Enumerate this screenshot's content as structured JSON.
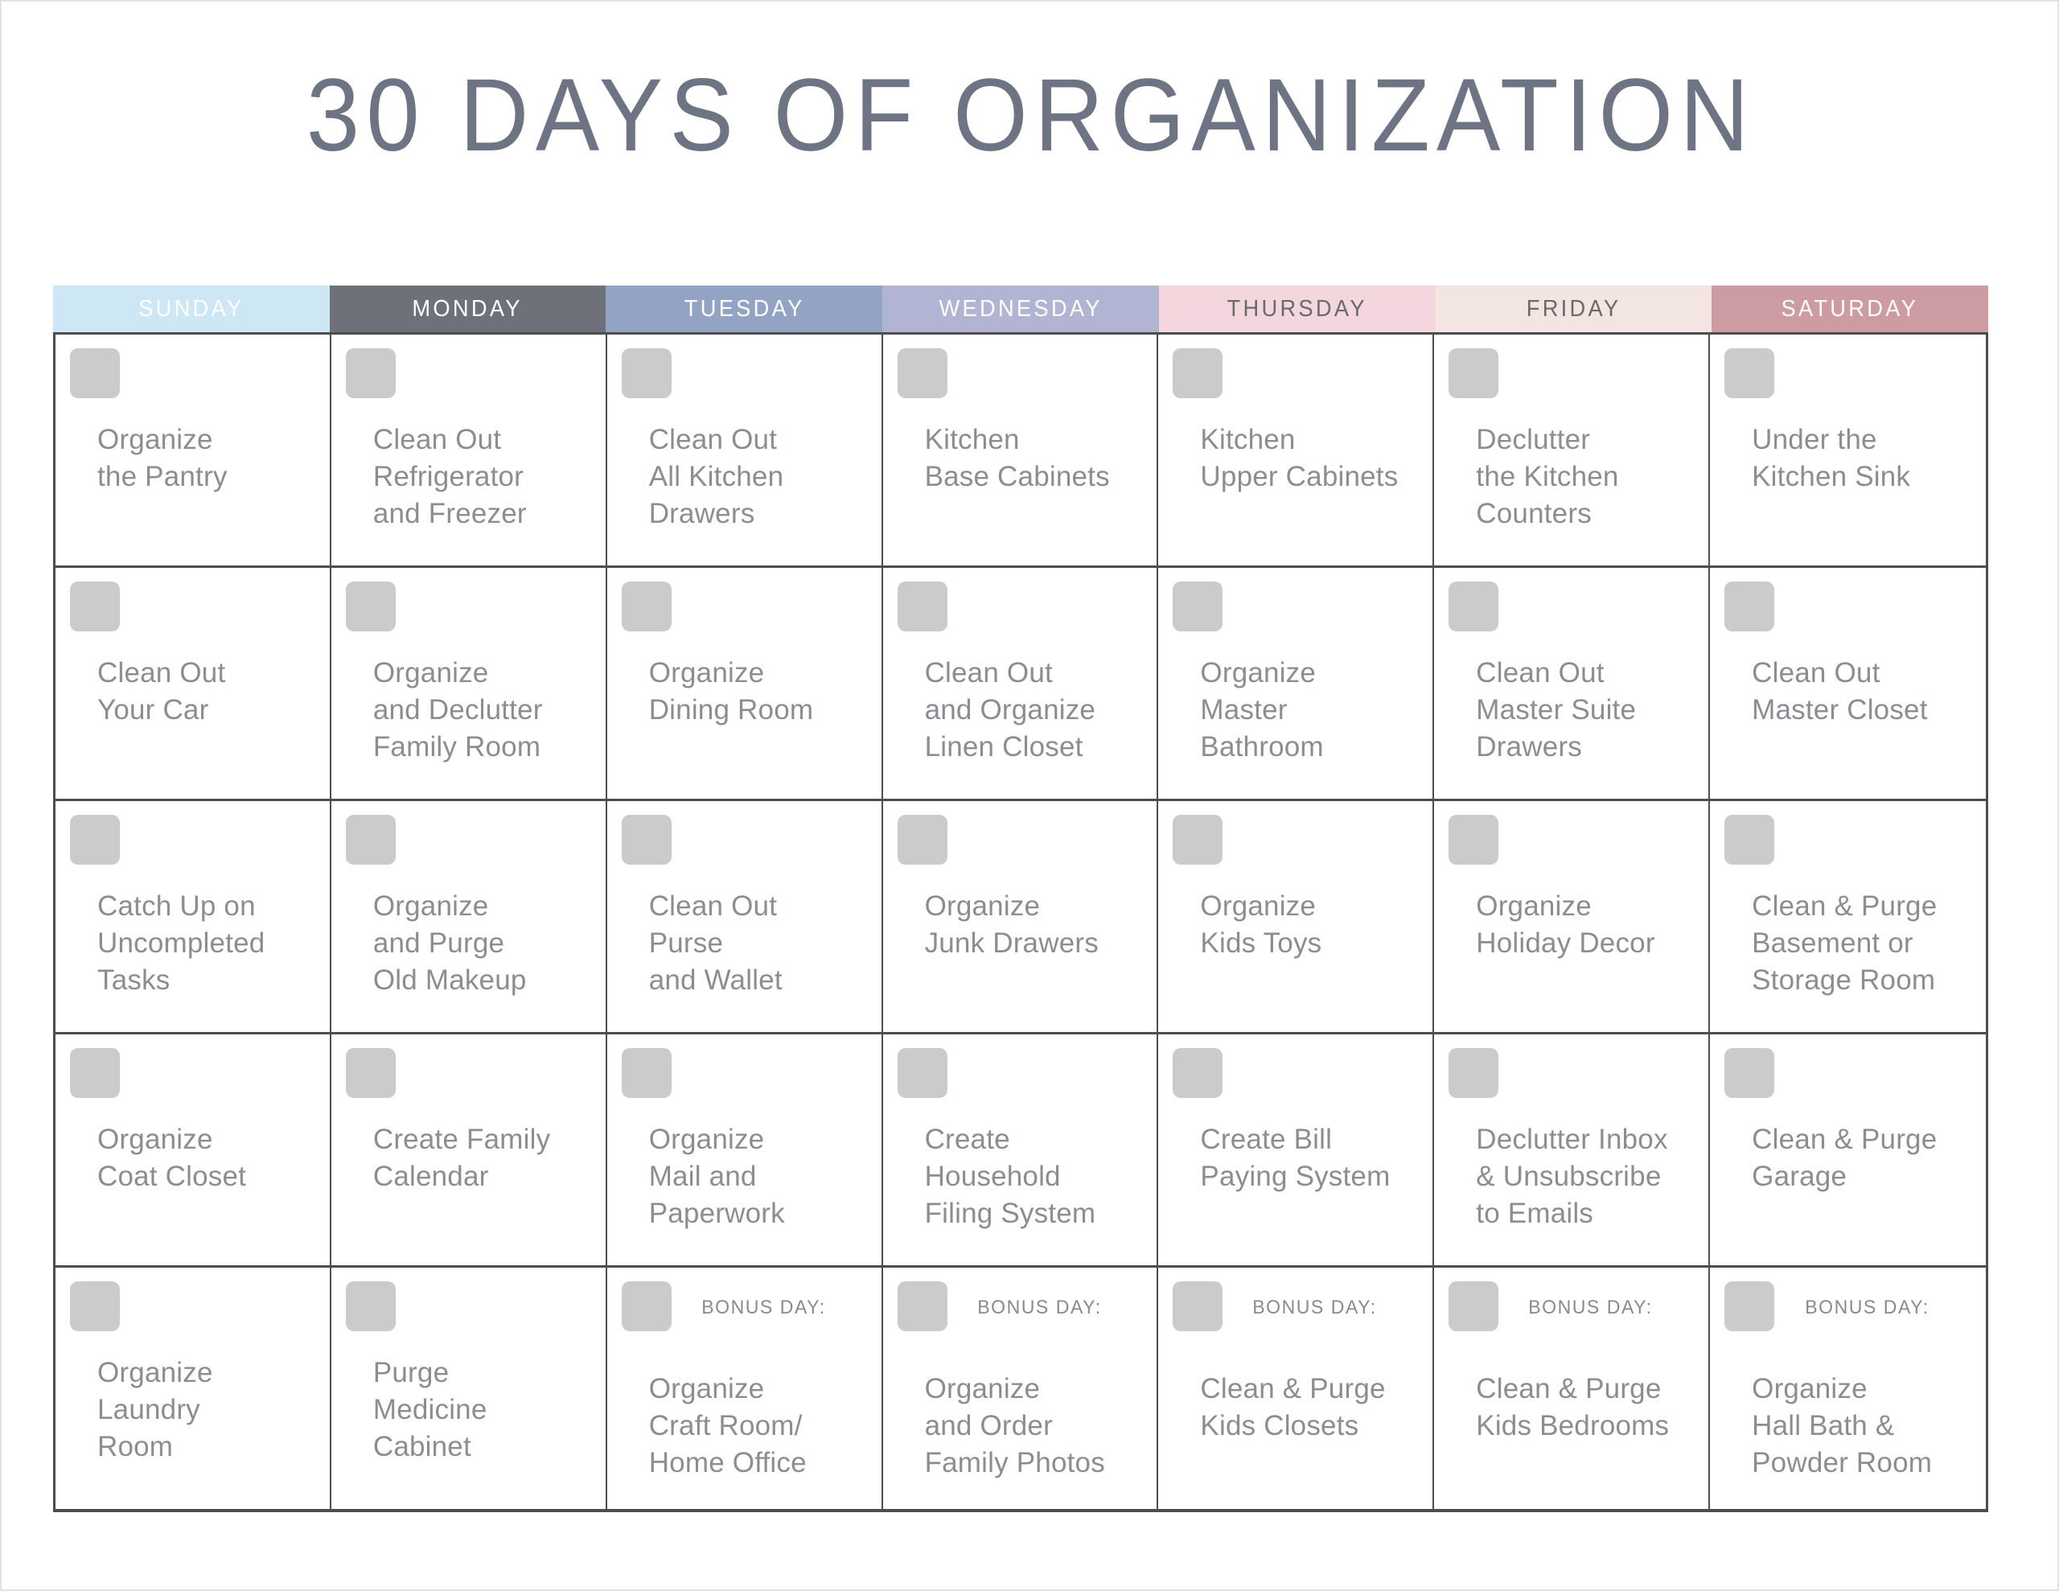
{
  "page": {
    "title": "30 DAYS OF ORGANIZATION",
    "bonus_label": "BONUS DAY:",
    "colors": {
      "title_text": "#6e7484",
      "task_text": "#8a8e93",
      "checkbox": "#cbcbcb",
      "grid_border": "#4d4d4d",
      "page_border": "#e2e2e2"
    }
  },
  "headers": [
    {
      "label": "SUNDAY",
      "bg": "#cde7f4",
      "fg": "#ffffff"
    },
    {
      "label": "MONDAY",
      "bg": "#6f717a",
      "fg": "#ffffff"
    },
    {
      "label": "TUESDAY",
      "bg": "#93a3c4",
      "fg": "#ffffff"
    },
    {
      "label": "WEDNESDAY",
      "bg": "#b1b4d2",
      "fg": "#ffffff"
    },
    {
      "label": "THURSDAY",
      "bg": "#f3d6de",
      "fg": "#6a6a6a"
    },
    {
      "label": "FRIDAY",
      "bg": "#f3e5e2",
      "fg": "#6a6a6a"
    },
    {
      "label": "SATURDAY",
      "bg": "#cd9ba2",
      "fg": "#ffffff"
    }
  ],
  "weeks": [
    [
      {
        "task": "Organize\nthe Pantry",
        "bonus": false
      },
      {
        "task": "Clean Out\nRefrigerator\nand Freezer",
        "bonus": false
      },
      {
        "task": "Clean Out\nAll Kitchen\nDrawers",
        "bonus": false
      },
      {
        "task": "Kitchen\nBase Cabinets",
        "bonus": false
      },
      {
        "task": "Kitchen\nUpper Cabinets",
        "bonus": false
      },
      {
        "task": "Declutter\nthe Kitchen\nCounters",
        "bonus": false
      },
      {
        "task": "Under the\nKitchen Sink",
        "bonus": false
      }
    ],
    [
      {
        "task": "Clean Out\nYour Car",
        "bonus": false
      },
      {
        "task": "Organize\nand Declutter\nFamily Room",
        "bonus": false
      },
      {
        "task": "Organize\nDining Room",
        "bonus": false
      },
      {
        "task": "Clean Out\nand Organize\nLinen Closet",
        "bonus": false
      },
      {
        "task": "Organize\nMaster\nBathroom",
        "bonus": false
      },
      {
        "task": "Clean Out\nMaster Suite\nDrawers",
        "bonus": false
      },
      {
        "task": "Clean Out\nMaster Closet",
        "bonus": false
      }
    ],
    [
      {
        "task": "Catch Up on\nUncompleted\nTasks",
        "bonus": false
      },
      {
        "task": "Organize\nand Purge\nOld Makeup",
        "bonus": false
      },
      {
        "task": "Clean Out\nPurse\nand Wallet",
        "bonus": false
      },
      {
        "task": "Organize\nJunk Drawers",
        "bonus": false
      },
      {
        "task": "Organize\nKids Toys",
        "bonus": false
      },
      {
        "task": "Organize\nHoliday Decor",
        "bonus": false
      },
      {
        "task": "Clean & Purge\nBasement or\nStorage Room",
        "bonus": false
      }
    ],
    [
      {
        "task": "Organize\nCoat Closet",
        "bonus": false
      },
      {
        "task": "Create Family\nCalendar",
        "bonus": false
      },
      {
        "task": "Organize\nMail and\nPaperwork",
        "bonus": false
      },
      {
        "task": "Create\nHousehold\nFiling System",
        "bonus": false
      },
      {
        "task": "Create Bill\nPaying System",
        "bonus": false
      },
      {
        "task": "Declutter Inbox\n& Unsubscribe\nto Emails",
        "bonus": false
      },
      {
        "task": "Clean & Purge\nGarage",
        "bonus": false
      }
    ],
    [
      {
        "task": "Organize\nLaundry\nRoom",
        "bonus": false
      },
      {
        "task": "Purge\nMedicine\nCabinet",
        "bonus": false
      },
      {
        "task": "Organize\nCraft Room/\nHome Office",
        "bonus": true
      },
      {
        "task": "Organize\nand Order\nFamily Photos",
        "bonus": true
      },
      {
        "task": "Clean & Purge\nKids Closets",
        "bonus": true
      },
      {
        "task": "Clean & Purge\nKids Bedrooms",
        "bonus": true
      },
      {
        "task": "Organize\nHall Bath &\nPowder Room",
        "bonus": true
      }
    ]
  ]
}
